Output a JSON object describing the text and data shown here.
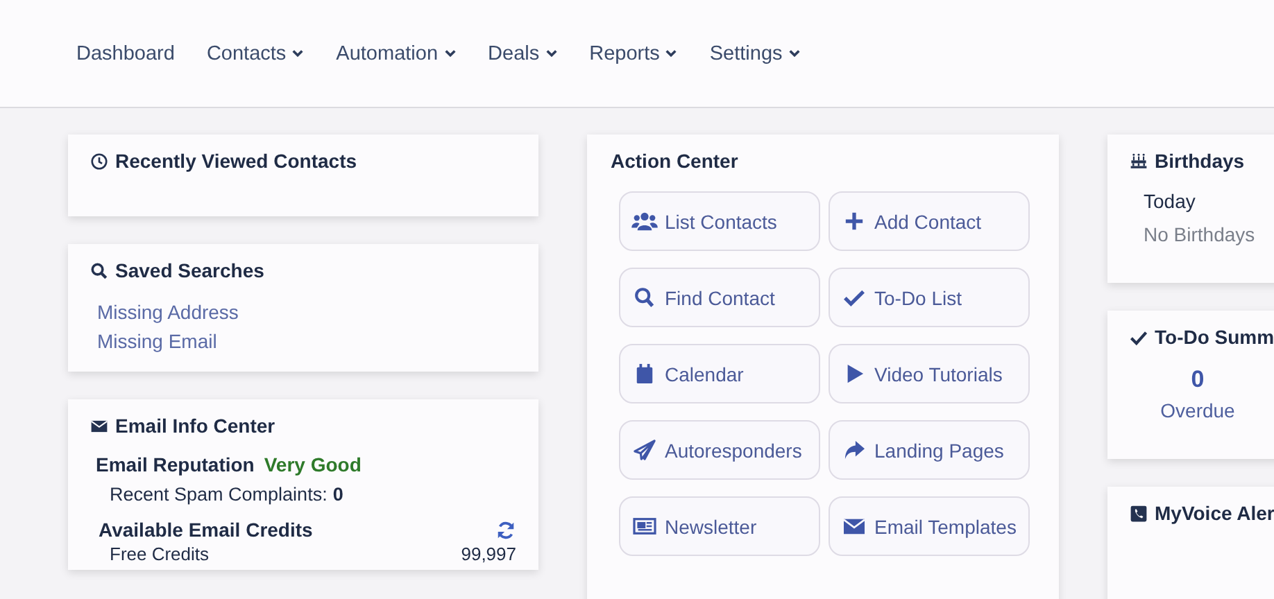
{
  "nav": [
    {
      "label": "Dashboard",
      "dropdown": false
    },
    {
      "label": "Contacts",
      "dropdown": true
    },
    {
      "label": "Automation",
      "dropdown": true
    },
    {
      "label": "Deals",
      "dropdown": true
    },
    {
      "label": "Reports",
      "dropdown": true
    },
    {
      "label": "Settings",
      "dropdown": true
    }
  ],
  "recently_viewed": {
    "title": "Recently Viewed Contacts"
  },
  "saved_searches": {
    "title": "Saved Searches",
    "items": [
      "Missing Address",
      "Missing Email"
    ]
  },
  "email_info": {
    "title": "Email Info Center",
    "reputation_label": "Email Reputation",
    "reputation_value": "Very Good",
    "spam_label": "Recent Spam Complaints:",
    "spam_value": "0",
    "credits_title": "Available Email Credits",
    "credits_rows": [
      {
        "label": "Free Credits",
        "value": "99,997"
      }
    ]
  },
  "action_center": {
    "title": "Action Center",
    "buttons": [
      {
        "label": "List Contacts",
        "kind": "users"
      },
      {
        "label": "Add Contact",
        "kind": "plus"
      },
      {
        "label": "Find Contact",
        "kind": "search"
      },
      {
        "label": "To-Do List",
        "kind": "check"
      },
      {
        "label": "Calendar",
        "kind": "calendar"
      },
      {
        "label": "Video Tutorials",
        "kind": "play"
      },
      {
        "label": "Autoresponders",
        "kind": "plane"
      },
      {
        "label": "Landing Pages",
        "kind": "share"
      },
      {
        "label": "Newsletter",
        "kind": "newspaper"
      },
      {
        "label": "Email Templates",
        "kind": "envelope"
      }
    ]
  },
  "birthdays": {
    "title": "Birthdays",
    "heading": "Today",
    "empty_text": "No Birthdays"
  },
  "todo_summary": {
    "title": "To-Do Summ",
    "count": "0",
    "label": "Overdue"
  },
  "myvoice": {
    "title": "MyVoice Aler"
  }
}
